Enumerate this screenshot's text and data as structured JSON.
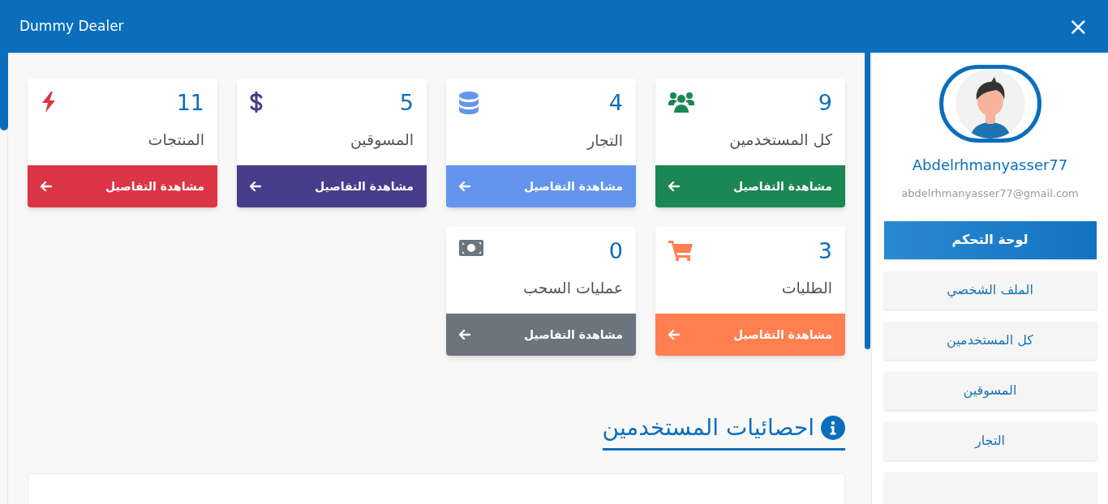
{
  "window": {
    "title": "Dummy Dealer",
    "close": "×"
  },
  "cards": [
    {
      "kind": "users",
      "number": "9",
      "label": "كل المستخدمين",
      "link": "مشاهدة التفاصيل",
      "color": "#1a8754"
    },
    {
      "kind": "database",
      "number": "4",
      "label": "التجار",
      "link": "مشاهدة التفاصيل",
      "color": "#6495ed"
    },
    {
      "kind": "dollar",
      "number": "5",
      "label": "المسوقين",
      "link": "مشاهدة التفاصيل",
      "color": "#483d8b"
    },
    {
      "kind": "bolt",
      "number": "11",
      "label": "المنتجات",
      "link": "مشاهدة التفاصيل",
      "color": "#dc3545"
    },
    {
      "kind": "cart",
      "number": "3",
      "label": "الطلبات",
      "link": "مشاهدة التفاصيل",
      "color": "#ff7f50"
    },
    {
      "kind": "money",
      "number": "0",
      "label": "عمليات السحب",
      "link": "مشاهدة التفاصيل",
      "color": "#6c757d"
    }
  ],
  "section": {
    "title": "احصائيات المستخدمين"
  },
  "profile": {
    "username": "Abdelrhmanyasser77",
    "email": "abdelrhmanyasser77@gmail.com"
  },
  "menu": [
    {
      "label": "لوحة التحكم",
      "selected": true
    },
    {
      "label": "الملف الشخصي",
      "selected": false
    },
    {
      "label": "كل المستخدمين",
      "selected": false
    },
    {
      "label": "المسوقين",
      "selected": false
    },
    {
      "label": "التجار",
      "selected": false
    }
  ]
}
